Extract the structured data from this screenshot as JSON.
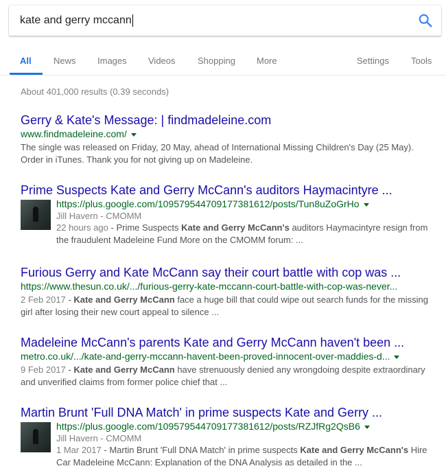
{
  "search": {
    "query": "kate and gerry mccann"
  },
  "tabs": {
    "all": "All",
    "news": "News",
    "images": "Images",
    "videos": "Videos",
    "shopping": "Shopping",
    "more": "More",
    "settings": "Settings",
    "tools": "Tools"
  },
  "stats": "About 401,000 results (0.39 seconds)",
  "colors": {
    "title": "#1a0dab",
    "url": "#006621",
    "snippet": "#545454",
    "accent": "#1a73e8"
  },
  "results": [
    {
      "title": "Gerry & Kate's Message: | findmadeleine.com",
      "url": "www.findmadeleine.com/",
      "snippet": "The single was released on Friday, 20 May, ahead of International Missing Children's Day (25 May). Order in iTunes. Thank you for not giving up on Madeleine."
    },
    {
      "title": "Prime Suspects Kate and Gerry McCann's auditors Haymacintyre ...",
      "url": "https://plus.google.com/109579544709177381612/posts/Tun8uZoGrHo",
      "author": "Jill Havern - CMOMM",
      "date": "22 hours ago",
      "snippet_a": "Prime Suspects ",
      "bold": "Kate and Gerry McCann's",
      "snippet_b": " auditors Haymacintyre resign from the fraudulent Madeleine Fund More on the CMOMM forum: ..."
    },
    {
      "title": "Furious Gerry and Kate McCann say their court battle with cop was ...",
      "url": "https://www.thesun.co.uk/.../furious-gerry-kate-mccann-court-battle-with-cop-was-never...",
      "date": "2 Feb 2017",
      "bold": "Kate and Gerry McCann",
      "snippet_b": " face a huge bill that could wipe out search funds for the missing girl after losing their new court appeal to silence ..."
    },
    {
      "title": "Madeleine McCann's parents Kate and Gerry McCann haven't been ...",
      "url": "metro.co.uk/.../kate-and-gerry-mccann-havent-been-proved-innocent-over-maddies-d...",
      "date": "9 Feb 2017",
      "bold": "Kate and Gerry McCann",
      "snippet_b": " have strenuously denied any wrongdoing despite extraordinary and unverified claims from former police chief that ..."
    },
    {
      "title": "Martin Brunt 'Full DNA Match' in prime suspects Kate and Gerry ...",
      "url": "https://plus.google.com/109579544709177381612/posts/RZJfRg2QsB6",
      "author": "Jill Havern - CMOMM",
      "date": "1 Mar 2017",
      "snippet_a": "Martin Brunt 'Full DNA Match' in prime suspects ",
      "bold": "Kate and Gerry McCann's",
      "snippet_b": " Hire Car Madeleine McCann: Explanation of the DNA Analysis as detailed in the ..."
    }
  ]
}
